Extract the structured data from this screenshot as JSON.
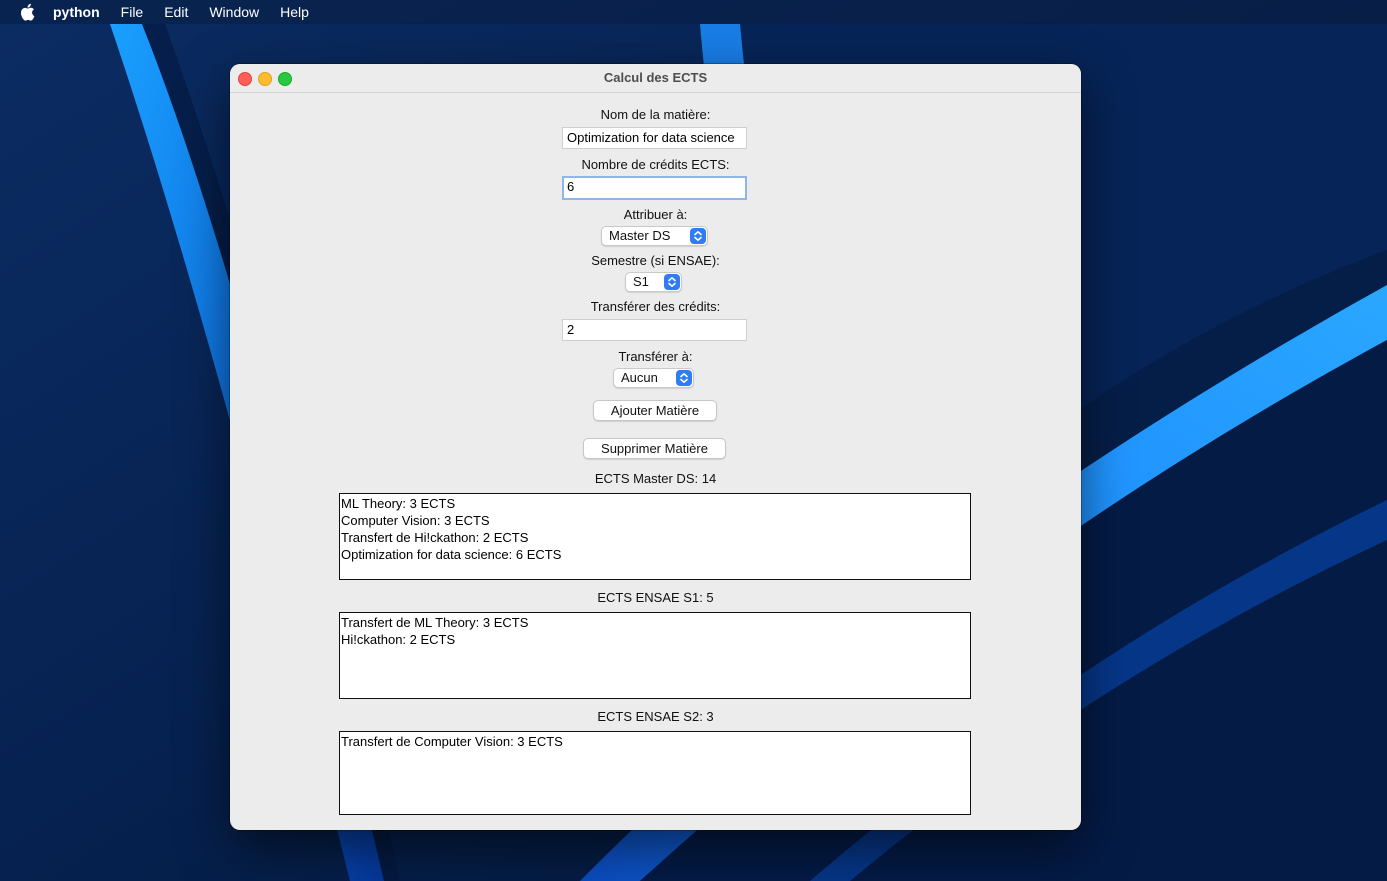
{
  "menubar": {
    "apple_icon": "apple-logo-icon",
    "items": [
      "python",
      "File",
      "Edit",
      "Window",
      "Help"
    ]
  },
  "window": {
    "title": "Calcul des ECTS",
    "controls": [
      "close-icon",
      "minimize-icon",
      "zoom-icon"
    ]
  },
  "form": {
    "subject_label": "Nom de la matière:",
    "subject_value": "Optimization for data science",
    "credits_label": "Nombre de crédits ECTS:",
    "credits_value": "6",
    "assign_label": "Attribuer à:",
    "assign_value": "Master DS",
    "semester_label": "Semestre (si ENSAE):",
    "semester_value": "S1",
    "transfer_credits_label": "Transférer des crédits:",
    "transfer_credits_value": "2",
    "transfer_to_label": "Transférer à:",
    "transfer_to_value": "Aucun",
    "add_button": "Ajouter Matière",
    "delete_button": "Supprimer Matière"
  },
  "lists": {
    "master_ds": {
      "title": "ECTS Master DS: 14",
      "items": [
        "ML Theory: 3 ECTS",
        "Computer Vision: 3 ECTS",
        "Transfert de Hi!ckathon: 2 ECTS",
        "Optimization for data science: 6 ECTS"
      ]
    },
    "ensae_s1": {
      "title": "ECTS ENSAE S1: 5",
      "items": [
        "Transfert de ML Theory: 3 ECTS",
        "Hi!ckathon: 2 ECTS"
      ]
    },
    "ensae_s2": {
      "title": "ECTS ENSAE S2: 3",
      "items": [
        "Transfert de Computer Vision: 3 ECTS"
      ]
    }
  },
  "colors": {
    "accent": "#2f7cf6",
    "focus_ring": "#8fb5ea",
    "window_bg": "#ececec"
  }
}
